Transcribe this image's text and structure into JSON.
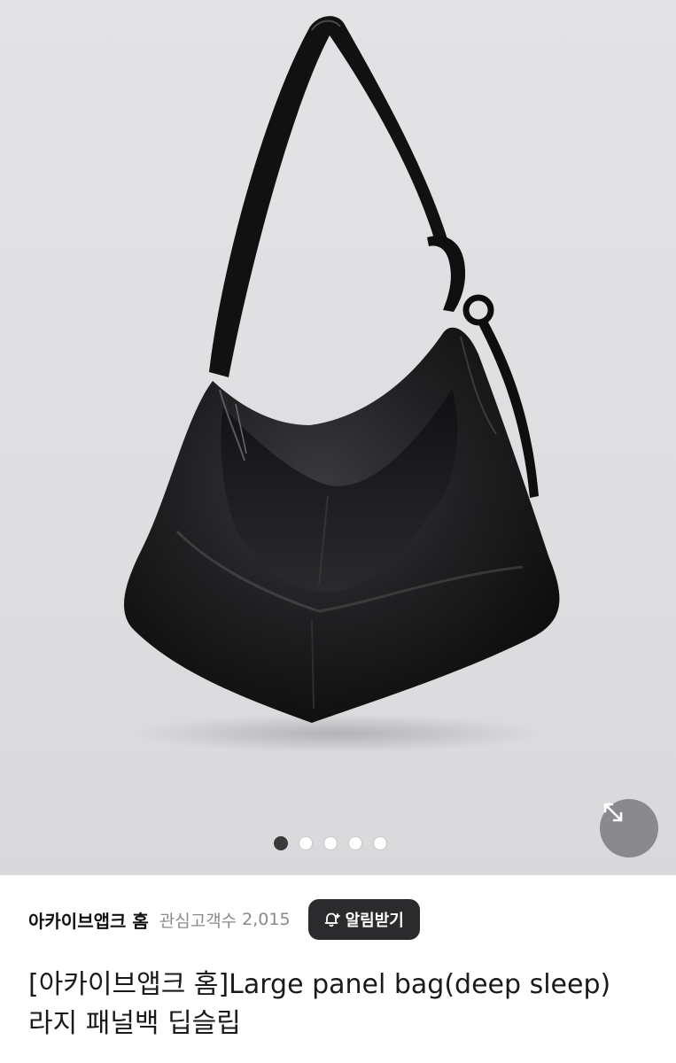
{
  "gallery": {
    "image_subject": "black-leather-shoulder-bag",
    "total_slides": 5,
    "active_slide": 1,
    "expand_icon": "expand-arrows-icon"
  },
  "store": {
    "name": "아카이브앱크 홈",
    "interest_label": "관심고객수",
    "interest_count": "2,015",
    "notify_icon": "bell-plus-icon",
    "notify_label": "알림받기"
  },
  "product": {
    "title_line1": "[아카이브앱크 홈]Large panel bag(deep sleep)",
    "title_line2": "라지 패널백 딥슬립"
  },
  "colors": {
    "hero_background": "#e0e0e3",
    "button_dark": "#2b2b2d",
    "muted_text": "#8a8a8e"
  }
}
